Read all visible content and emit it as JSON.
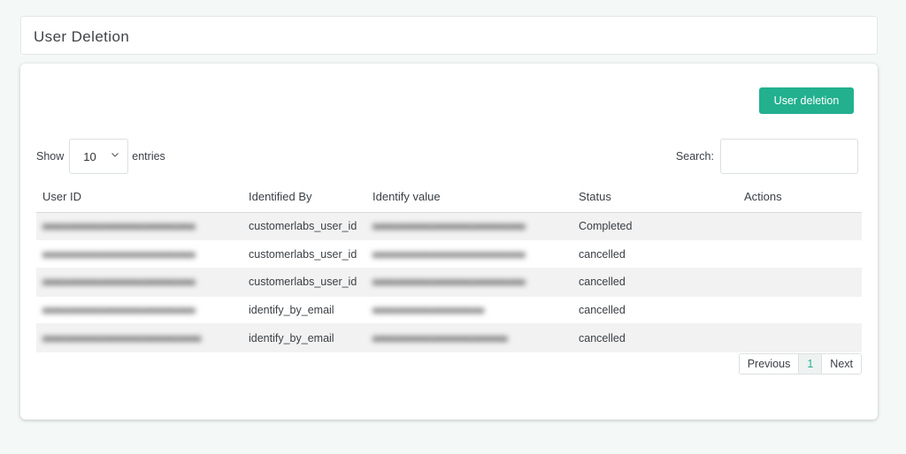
{
  "header": {
    "title": "User Deletion"
  },
  "toolbar": {
    "user_deletion_label": "User deletion"
  },
  "length_control": {
    "show_label": "Show",
    "selected": "10",
    "entries_label": "entries"
  },
  "search": {
    "label": "Search:",
    "value": "",
    "placeholder": ""
  },
  "table": {
    "columns": [
      "User ID",
      "Identified By",
      "Identify value",
      "Status",
      "Actions"
    ],
    "rows": [
      {
        "identified_by": "customerlabs_user_id",
        "status": "Completed",
        "actions": ""
      },
      {
        "identified_by": "customerlabs_user_id",
        "status": "cancelled",
        "actions": ""
      },
      {
        "identified_by": "customerlabs_user_id",
        "status": "cancelled",
        "actions": ""
      },
      {
        "identified_by": "identify_by_email",
        "status": "cancelled",
        "actions": ""
      },
      {
        "identified_by": "identify_by_email",
        "status": "cancelled",
        "actions": ""
      }
    ]
  },
  "pagination": {
    "previous_label": "Previous",
    "current_page": "1",
    "next_label": "Next"
  },
  "colors": {
    "accent": "#22b08f",
    "background": "#f4f8f7",
    "stripe": "#f2f2f2"
  },
  "icons": {
    "select_chevron": "chevron-down-icon"
  }
}
